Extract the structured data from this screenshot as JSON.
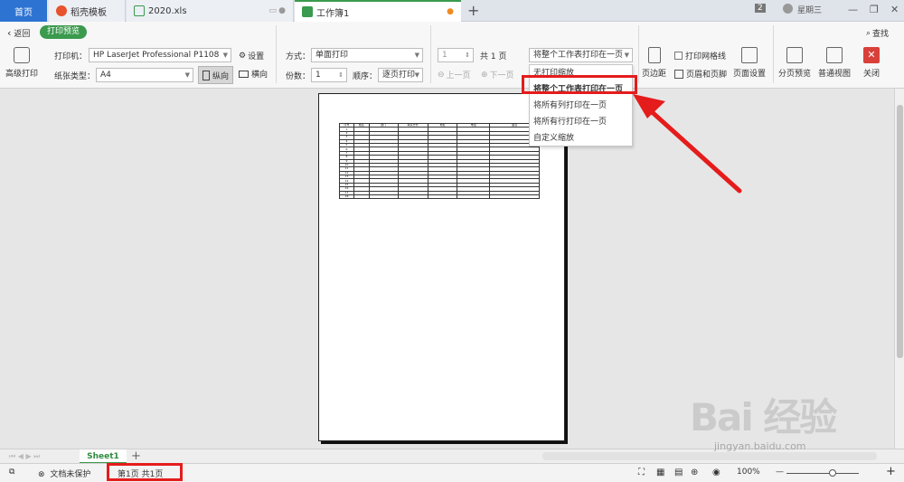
{
  "tabs": {
    "home": "首页",
    "t1": "稻壳模板",
    "t2": "2020.xls",
    "t3": "工作簿1",
    "user_count": "2",
    "user_name": "星期三"
  },
  "toolbar": {
    "back": "返回",
    "print_preview": "打印预览",
    "search": "查找",
    "advanced_print": "高级打印",
    "printer_label": "打印机：",
    "printer_value": "HP LaserJet Professional P1108",
    "settings": "设置",
    "paper_label": "纸张类型：",
    "paper_value": "A4",
    "portrait": "纵向",
    "landscape": "横向",
    "mode_label": "方式：",
    "mode_value": "单面打印",
    "copies_label": "份数：",
    "copies_value": "1",
    "order_label": "顺序：",
    "order_value": "逐页打印",
    "page_value": "1",
    "total_pages": "共 1 页",
    "prev_page": "上一页",
    "next_page": "下一页",
    "scale_value": "将整个工作表打印在一页",
    "gridlines": "打印网格线",
    "margins": "页边距",
    "header_footer": "页眉和页脚",
    "page_setup": "页面设置",
    "page_break_preview": "分页预览",
    "normal_view": "普通视图",
    "close": "关闭"
  },
  "dropdown": {
    "items": [
      "无打印缩放",
      "将整个工作表打印在一页",
      "将所有列打印在一页",
      "将所有行打印在一页",
      "自定义缩放"
    ]
  },
  "preview_table": {
    "headers": [
      "序号",
      "姓名",
      "部门",
      "联系方式",
      "地址",
      "电话",
      "备注"
    ],
    "rows": [
      "1",
      "2",
      "3",
      "4",
      "5",
      "6",
      "7",
      "8",
      "9",
      "10",
      "11",
      "12",
      "13",
      "14",
      "15",
      "16",
      "17",
      "18"
    ]
  },
  "sheet": {
    "tab": "Sheet1"
  },
  "status": {
    "protect": "文档未保护",
    "page_info": "第1页 共1页",
    "zoom": "100%"
  },
  "watermark": {
    "main": "Bai 经验",
    "url": "jingyan.baidu.com"
  },
  "colors": {
    "accent_green": "#3a9a4e",
    "home_blue": "#2d73d2",
    "highlight_red": "#e51c1c"
  }
}
